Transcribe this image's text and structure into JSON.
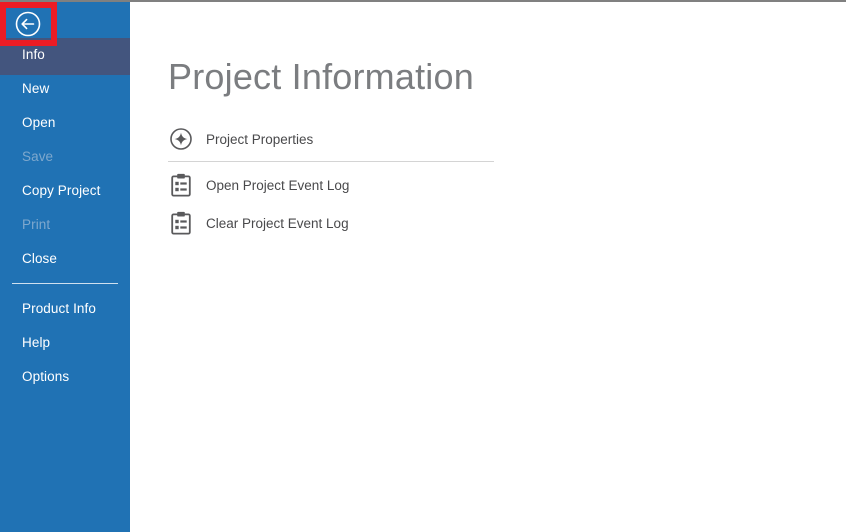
{
  "window": {
    "title": "Project Information"
  },
  "sidebar": {
    "back_button": {
      "label": "Back",
      "icon": "back-arrow-circle-icon"
    },
    "items": [
      {
        "label": "Info",
        "state": "selected"
      },
      {
        "label": "New",
        "state": "enabled"
      },
      {
        "label": "Open",
        "state": "enabled"
      },
      {
        "label": "Save",
        "state": "disabled"
      },
      {
        "label": "Copy Project",
        "state": "enabled"
      },
      {
        "label": "Print",
        "state": "disabled"
      },
      {
        "label": "Close",
        "state": "enabled"
      }
    ],
    "items_secondary": [
      {
        "label": "Product Info",
        "state": "enabled"
      },
      {
        "label": "Help",
        "state": "enabled"
      },
      {
        "label": "Options",
        "state": "enabled"
      }
    ]
  },
  "main": {
    "heading": "Project Information",
    "actions": [
      {
        "label": "Project Properties",
        "icon": "properties-star-circle-icon"
      },
      {
        "label": "Open Project Event Log",
        "icon": "clipboard-list-icon"
      },
      {
        "label": "Clear Project Event Log",
        "icon": "clipboard-list-icon"
      }
    ]
  },
  "annotation": {
    "highlight_target": "back-button",
    "color": "#ec1c24"
  },
  "colors": {
    "sidebar_background": "#2072b4",
    "sidebar_selected": "#43557e",
    "heading_text": "#7b7d80",
    "body_text": "#49494b",
    "disabled_text": "#7ea8cd",
    "content_background": "#ffffff",
    "separator": "#d4d4d4",
    "window_top_border": "#808080"
  }
}
